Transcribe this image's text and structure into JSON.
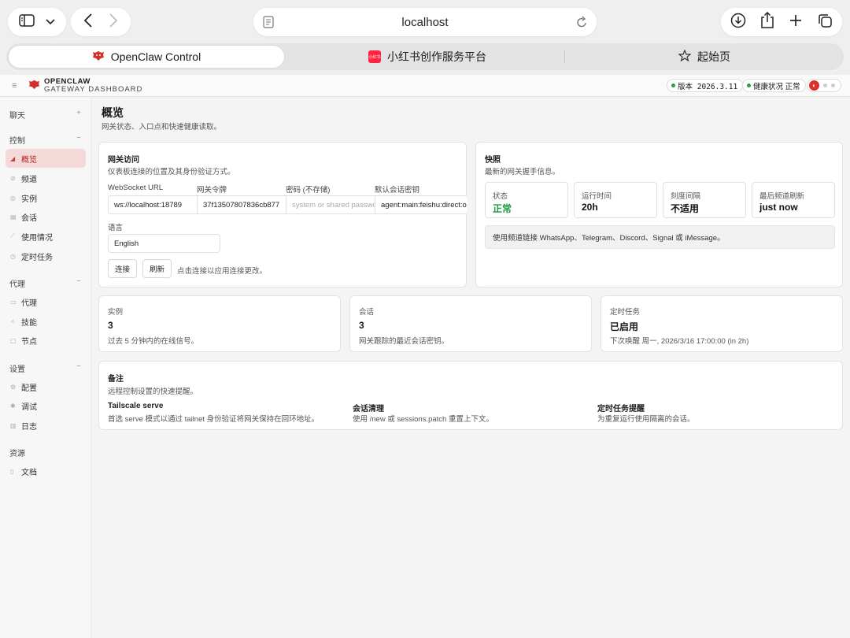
{
  "browser": {
    "url": "localhost",
    "tabs": [
      {
        "label": "OpenClaw Control"
      },
      {
        "label": "小红书创作服务平台",
        "favicon_text": "小红书"
      },
      {
        "label": "起始页"
      }
    ]
  },
  "header": {
    "brand_name": "OPENCLAW",
    "brand_sub": "GATEWAY DASHBOARD",
    "version_label": "版本 2026.3.11",
    "health_label": "健康状况 正常"
  },
  "sidebar": {
    "groups": [
      {
        "title": "聊天",
        "toggle": "+",
        "items": []
      },
      {
        "title": "控制",
        "toggle": "−",
        "items": [
          {
            "label": "概览",
            "icon": "overview-icon"
          },
          {
            "label": "频道",
            "icon": "link-icon"
          },
          {
            "label": "实例",
            "icon": "radio-icon"
          },
          {
            "label": "会话",
            "icon": "document-icon"
          },
          {
            "label": "使用情况",
            "icon": "chart-icon"
          },
          {
            "label": "定时任务",
            "icon": "clock-icon"
          }
        ]
      },
      {
        "title": "代理",
        "toggle": "−",
        "items": [
          {
            "label": "代理",
            "icon": "folder-icon"
          },
          {
            "label": "技能",
            "icon": "sparkle-icon"
          },
          {
            "label": "节点",
            "icon": "monitor-icon"
          }
        ]
      },
      {
        "title": "设置",
        "toggle": "−",
        "items": [
          {
            "label": "配置",
            "icon": "gear-icon"
          },
          {
            "label": "调试",
            "icon": "bug-icon"
          },
          {
            "label": "日志",
            "icon": "log-icon"
          }
        ]
      },
      {
        "title": "资源",
        "toggle": "",
        "items": [
          {
            "label": "文档",
            "icon": "book-icon"
          }
        ]
      }
    ]
  },
  "page": {
    "title": "概览",
    "subtitle": "网关状态、入口点和快速健康读取。"
  },
  "gateway": {
    "title": "网关访问",
    "subtitle": "仪表板连接的位置及其身份验证方式。",
    "fields": {
      "ws_label": "WebSocket URL",
      "ws_value": "ws://localhost:18789",
      "token_label": "网关令牌",
      "token_value": "37f13507807836cb877",
      "password_label": "密码 (不存储)",
      "password_placeholder": "system or shared password",
      "session_label": "默认会话密钥",
      "session_value": "agent:main:feishu:direct:ou",
      "lang_label": "语言",
      "lang_value": "English"
    },
    "connect_label": "连接",
    "refresh_label": "刷新",
    "hint": "点击连接以应用连接更改。"
  },
  "snapshot": {
    "title": "快照",
    "subtitle": "最新的网关握手信息。",
    "stats": [
      {
        "label": "状态",
        "value": "正常"
      },
      {
        "label": "运行时间",
        "value": "20h"
      },
      {
        "label": "刻度间隔",
        "value": "不适用"
      },
      {
        "label": "最后频道刷新",
        "value": "just now"
      }
    ],
    "info": "使用频道链接 WhatsApp、Telegram、Discord、Signal 或 iMessage。"
  },
  "summary": [
    {
      "label": "实例",
      "value": "3",
      "sub": "过去 5 分钟内的在线信号。"
    },
    {
      "label": "会话",
      "value": "3",
      "sub": "网关跟踪的最近会话密钥。"
    },
    {
      "label": "定时任务",
      "value": "已启用",
      "sub": "下次唤醒 周一, 2026/3/16 17:00:00 (in 2h)"
    }
  ],
  "notes": {
    "title": "备注",
    "subtitle": "远程控制设置的快速提醒。",
    "items": [
      {
        "title": "Tailscale serve",
        "text": "首选 serve 模式以通过 tailnet 身份验证将网关保持在回环地址。"
      },
      {
        "title": "会话清理",
        "text": "使用 /new 或 sessions.patch 重置上下文。"
      },
      {
        "title": "定时任务提醒",
        "text": "为重复运行使用隔离的会话。"
      }
    ]
  },
  "colors": {
    "accent": "#e0302c",
    "ok": "#1f9a40",
    "active_bg": "#f5d9d9"
  }
}
